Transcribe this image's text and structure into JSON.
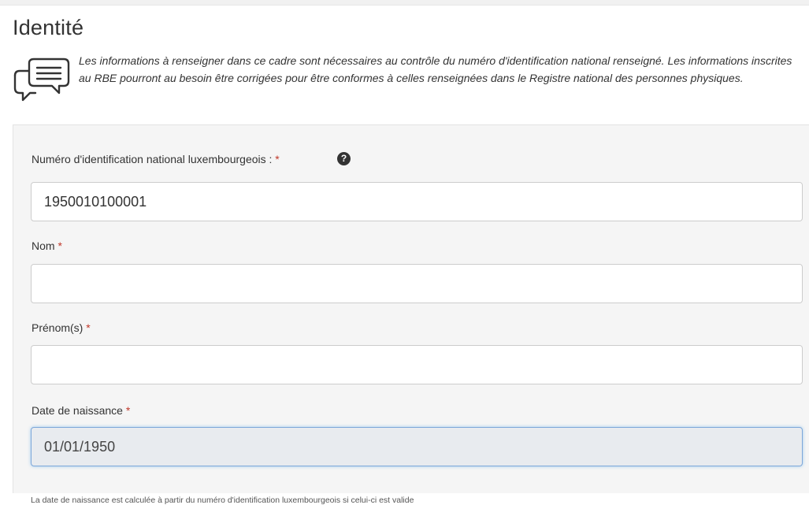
{
  "section": {
    "title": "Identité",
    "notice_icon": "chat-bubbles-icon",
    "notice": "Les informations à renseigner dans ce cadre sont nécessaires au contrôle du numéro d'identification national renseigné. Les informations inscrites au RBE pourront au besoin être corrigées pour être conformes à celles renseignées dans le Registre national des personnes physiques."
  },
  "form": {
    "nin": {
      "label": "Numéro d'identification national luxembourgeois : ",
      "required_mark": "*",
      "help_glyph": "?",
      "value": "1950010100001"
    },
    "nom": {
      "label": "Nom ",
      "required_mark": "*",
      "value": ""
    },
    "prenom": {
      "label": "Prénom(s) ",
      "required_mark": "*",
      "value": ""
    },
    "date_naissance": {
      "label": "Date de naissance ",
      "required_mark": "*",
      "value": "01/01/1950",
      "hint": "La date de naissance est calculée à partir du numéro d'identification luxembourgeois si celui-ci est valide"
    }
  },
  "colors": {
    "required": "#c0392b",
    "panel_background": "#f5f5f5",
    "readonly_background": "#e8ebef",
    "focus_border": "#7da7d9"
  }
}
